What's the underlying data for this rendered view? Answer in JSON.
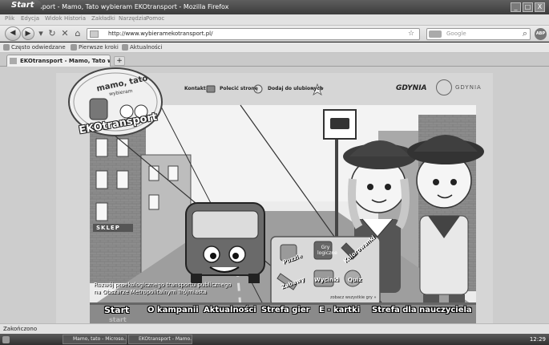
{
  "window": {
    "title": "EKOtransport - Mamo, Tato wybieram EKOtransport - Mozilla Firefox",
    "controls": [
      "_",
      "□",
      "X"
    ]
  },
  "menu": [
    "Plik",
    "Edycja",
    "Widok",
    "Historia",
    "Zakładki",
    "Narzędzia",
    "Pomoc"
  ],
  "toolbar": {
    "url": "http://www.wybieramekotransport.pl/",
    "search_placeholder": "Google"
  },
  "bookmarks": [
    "Często odwiedzane",
    "Pierwsze kroki",
    "Aktualności"
  ],
  "tab": {
    "title": "EKOtransport - Mamo, Tato wybiera...",
    "new_tab": "+"
  },
  "site": {
    "logo": {
      "line1": "mamo, tato",
      "line2": "wybieram",
      "brand": "EKOtransport"
    },
    "top_links": [
      "Kontakt",
      "Polecić stronę",
      "Dodaj do ulubionych"
    ],
    "partner_logos": [
      "GDYNIA",
      "GDYNIA"
    ],
    "bus_sign": "SKLEP",
    "caption_line1": "Rozwój proekologicznego transportu publicznego",
    "caption_line2": "na Obszarze Metropolitalnym Trójmiasta",
    "games": [
      "Puzzle",
      "Gry logiczne",
      "Kolorowanki",
      "Zabawy",
      "Wycinki",
      "Quiz"
    ],
    "games_more": "zobacz wszystkie gry »",
    "nav": [
      "Start",
      "O kampanii",
      "Aktualności",
      "Strefa gier",
      "E - kartki",
      "Strefa dla nauczyciela"
    ],
    "start_shadow": "start"
  },
  "status": "Zakończono",
  "taskbar": {
    "start": "Start",
    "tasks": [
      "Mamo, tato - Microso...",
      "EKOtransport - Mamo..."
    ],
    "clock": "12:29"
  }
}
